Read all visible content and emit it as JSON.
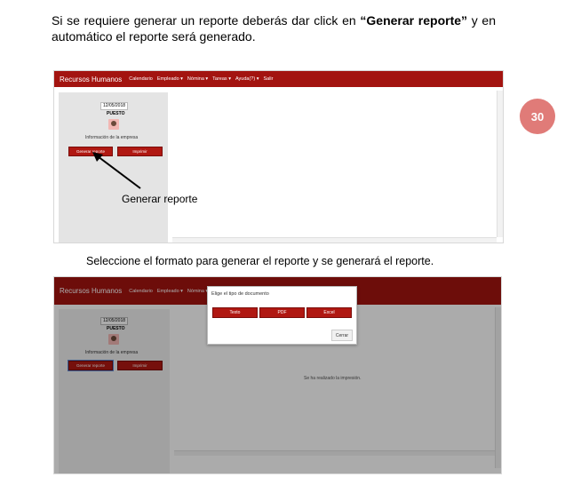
{
  "intro": {
    "text_before": "Si se requiere generar un reporte deberás dar click en ",
    "bold": "“Generar reporte”",
    "text_after": " y en automático el reporte será generado."
  },
  "page_number": "30",
  "screen1": {
    "brand": "Recursos Humanos",
    "nav": [
      "Calendario",
      "Empleado ▾",
      "Nómina ▾",
      "Tareas ▾",
      "Ayuda(?) ▾",
      "Salir"
    ],
    "date": "12/05/2018",
    "position": "PUESTO",
    "company_info": "Información de la empresa",
    "generate_button": "Generar reporte",
    "print_button": "Imprimir",
    "callout": "Generar reporte"
  },
  "caption2": "Seleccione el formato para generar el reporte y se generará el reporte.",
  "screen2": {
    "brand": "Recursos Humanos",
    "nav": [
      "Calendario",
      "Empleado ▾",
      "Nómina ▾"
    ],
    "date": "12/05/2018",
    "position": "PUESTO",
    "company_info": "Información de la empresa",
    "generate_button": "Generar reporte",
    "print_button": "Imprimir",
    "status": "Se ha realizado la impresión.",
    "modal": {
      "title": "Elige el tipo de documento",
      "options": [
        "Texto",
        "PDF",
        "Excel"
      ],
      "close": "Cerrar"
    }
  }
}
